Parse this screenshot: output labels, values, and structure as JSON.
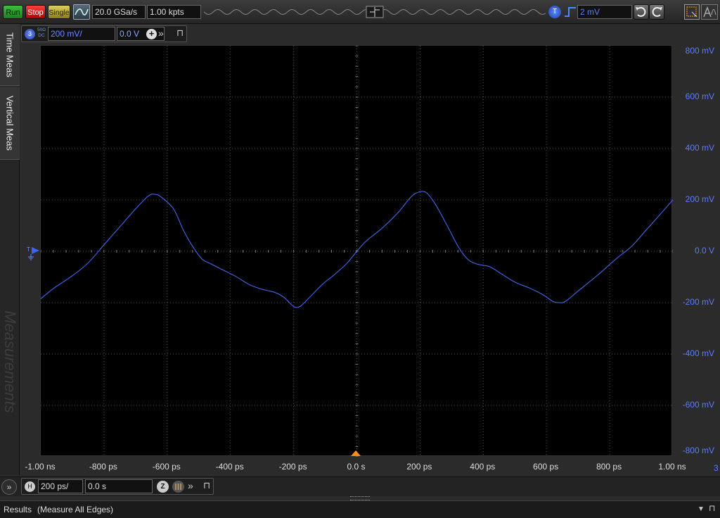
{
  "toolbar": {
    "run_label": "Run",
    "stop_label": "Stop",
    "single_label": "Single",
    "acquisition_icon": "waveform-acquire-icon",
    "sample_rate": "20.0 GSa/s",
    "memory_depth": "1.00 kpts",
    "trigger_badge": "T",
    "trigger_edge_icon": "rising-edge-icon",
    "trigger_level": "2 mV",
    "undo_icon": "undo-icon",
    "redo_icon": "redo-icon"
  },
  "side_tabs": {
    "time_meas": "Time Meas",
    "vertical_meas": "Vertical Meas",
    "watermark": "Measurements"
  },
  "channel": {
    "number": "3",
    "coupling": "50Ω DC",
    "volts_per_div": "200 mV/",
    "offset": "0.0 V",
    "color": "#4a6dff"
  },
  "graticule": {
    "y_labels": [
      "800 mV",
      "600 mV",
      "400 mV",
      "200 mV",
      "0.0 V",
      "-200 mV",
      "-400 mV",
      "-600 mV",
      "-800 mV"
    ],
    "x_labels": [
      "-1.00 ns",
      "-800 ps",
      "-600 ps",
      "-400 ps",
      "-200 ps",
      "0.0 s",
      "200 ps",
      "400 ps",
      "600 ps",
      "800 ps",
      "1.00 ns"
    ],
    "offscreen_indicator": "3",
    "ground_marker": "T"
  },
  "chart_data": {
    "type": "line",
    "xlabel": "",
    "ylabel": "",
    "xlim": [
      -1000,
      1000
    ],
    "ylim": [
      -800,
      800
    ],
    "grid": true,
    "series": [
      {
        "color": "#4a6dff",
        "points": [
          [
            -1000,
            -185
          ],
          [
            -960,
            -145
          ],
          [
            -900,
            -95
          ],
          [
            -850,
            -45
          ],
          [
            -800,
            25
          ],
          [
            -750,
            95
          ],
          [
            -700,
            165
          ],
          [
            -660,
            215
          ],
          [
            -640,
            222
          ],
          [
            -620,
            212
          ],
          [
            -580,
            165
          ],
          [
            -550,
            85
          ],
          [
            -520,
            20
          ],
          [
            -490,
            -30
          ],
          [
            -460,
            -50
          ],
          [
            -420,
            -75
          ],
          [
            -380,
            -100
          ],
          [
            -340,
            -130
          ],
          [
            -300,
            -148
          ],
          [
            -260,
            -160
          ],
          [
            -230,
            -180
          ],
          [
            -200,
            -215
          ],
          [
            -180,
            -215
          ],
          [
            -150,
            -180
          ],
          [
            -110,
            -130
          ],
          [
            -70,
            -90
          ],
          [
            -30,
            -45
          ],
          [
            0,
            0
          ],
          [
            30,
            40
          ],
          [
            80,
            90
          ],
          [
            130,
            150
          ],
          [
            170,
            210
          ],
          [
            195,
            230
          ],
          [
            220,
            228
          ],
          [
            250,
            180
          ],
          [
            290,
            90
          ],
          [
            320,
            20
          ],
          [
            350,
            -30
          ],
          [
            380,
            -50
          ],
          [
            420,
            -60
          ],
          [
            460,
            -90
          ],
          [
            500,
            -120
          ],
          [
            550,
            -145
          ],
          [
            590,
            -170
          ],
          [
            620,
            -195
          ],
          [
            640,
            -200
          ],
          [
            660,
            -195
          ],
          [
            700,
            -155
          ],
          [
            760,
            -95
          ],
          [
            820,
            -30
          ],
          [
            870,
            20
          ],
          [
            910,
            75
          ],
          [
            950,
            130
          ],
          [
            1000,
            200
          ]
        ]
      }
    ]
  },
  "horizontal": {
    "badge": "H",
    "time_per_div": "200 ps/",
    "delay": "0.0 s",
    "zoom_label": "Z"
  },
  "results": {
    "title": "Results",
    "subtitle": "(Measure All Edges)"
  }
}
